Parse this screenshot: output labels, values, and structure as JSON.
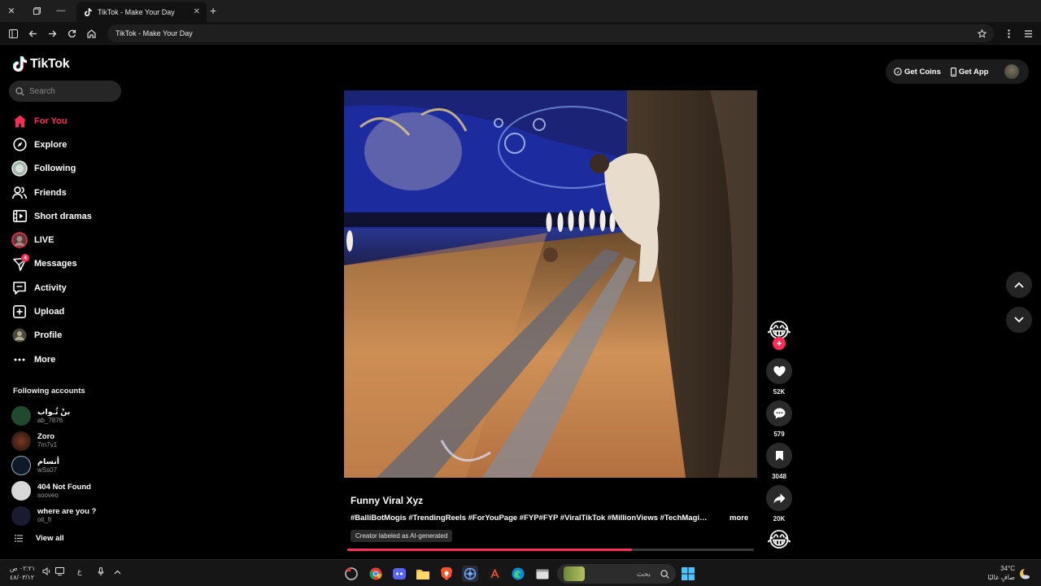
{
  "browser": {
    "tab_title": "TikTok - Make Your Day",
    "url": "TikTok - Make Your Day",
    "new_tab": "+",
    "close": "✕"
  },
  "sidebar": {
    "logo": "TikTok",
    "search_placeholder": "Search",
    "nav": [
      {
        "label": "For You",
        "icon": "home-icon",
        "active": true
      },
      {
        "label": "Explore",
        "icon": "compass-icon"
      },
      {
        "label": "Following",
        "icon": "following-avatar-icon"
      },
      {
        "label": "Friends",
        "icon": "friends-icon"
      },
      {
        "label": "Short dramas",
        "icon": "film-icon"
      },
      {
        "label": "LIVE",
        "icon": "live-avatar-icon"
      },
      {
        "label": "Messages",
        "icon": "paper-plane-icon",
        "badge": "4"
      },
      {
        "label": "Activity",
        "icon": "message-square-icon"
      },
      {
        "label": "Upload",
        "icon": "plus-square-icon"
      },
      {
        "label": "Profile",
        "icon": "profile-avatar-icon"
      },
      {
        "label": "More",
        "icon": "more-icon"
      }
    ],
    "following_title": "Following accounts",
    "accounts": [
      {
        "name": "بنْ ثُـواب",
        "handle": "ab_7876",
        "color": "#1f4a2e"
      },
      {
        "name": "Zoro",
        "handle": "7m7v1",
        "color": "#3a2a20"
      },
      {
        "name": "أنسام",
        "handle": "wSs07",
        "color": "#0d1a2a"
      },
      {
        "name": "404 Not Found",
        "handle": "sooveo",
        "color": "#d8d8d8"
      },
      {
        "name": "where are you ?",
        "handle": "oit_fr",
        "color": "#1a1a30"
      }
    ],
    "view_all": "View all"
  },
  "topbar": {
    "get_coins": "Get Coins",
    "get_app": "Get App"
  },
  "video": {
    "caption": "Funny Viral Xyz",
    "hashtags": "#BalliBotMogis #TrendingReels #ForYouPage #FYP#FYP #ViralTikTok #MillionViews #TechMagic #Funny #Viral",
    "more": "more",
    "ai_label": "Creator labeled as AI-generated",
    "progress": 0.7
  },
  "actions": {
    "likes": "52K",
    "comments": "579",
    "saves": "3048",
    "shares": "20K",
    "avatar_emoji": "😂",
    "music_emoji": "😂",
    "follow": "+"
  },
  "taskbar": {
    "time": "٠٢:٢١ ص",
    "date": "٤٨/٠٣/١٢",
    "lang": "ع",
    "search_text": "بحث",
    "temperature": "34°C",
    "weather": "صافٍ غالبًا"
  },
  "colors": {
    "accent": "#fe2c55",
    "background": "#000000"
  }
}
